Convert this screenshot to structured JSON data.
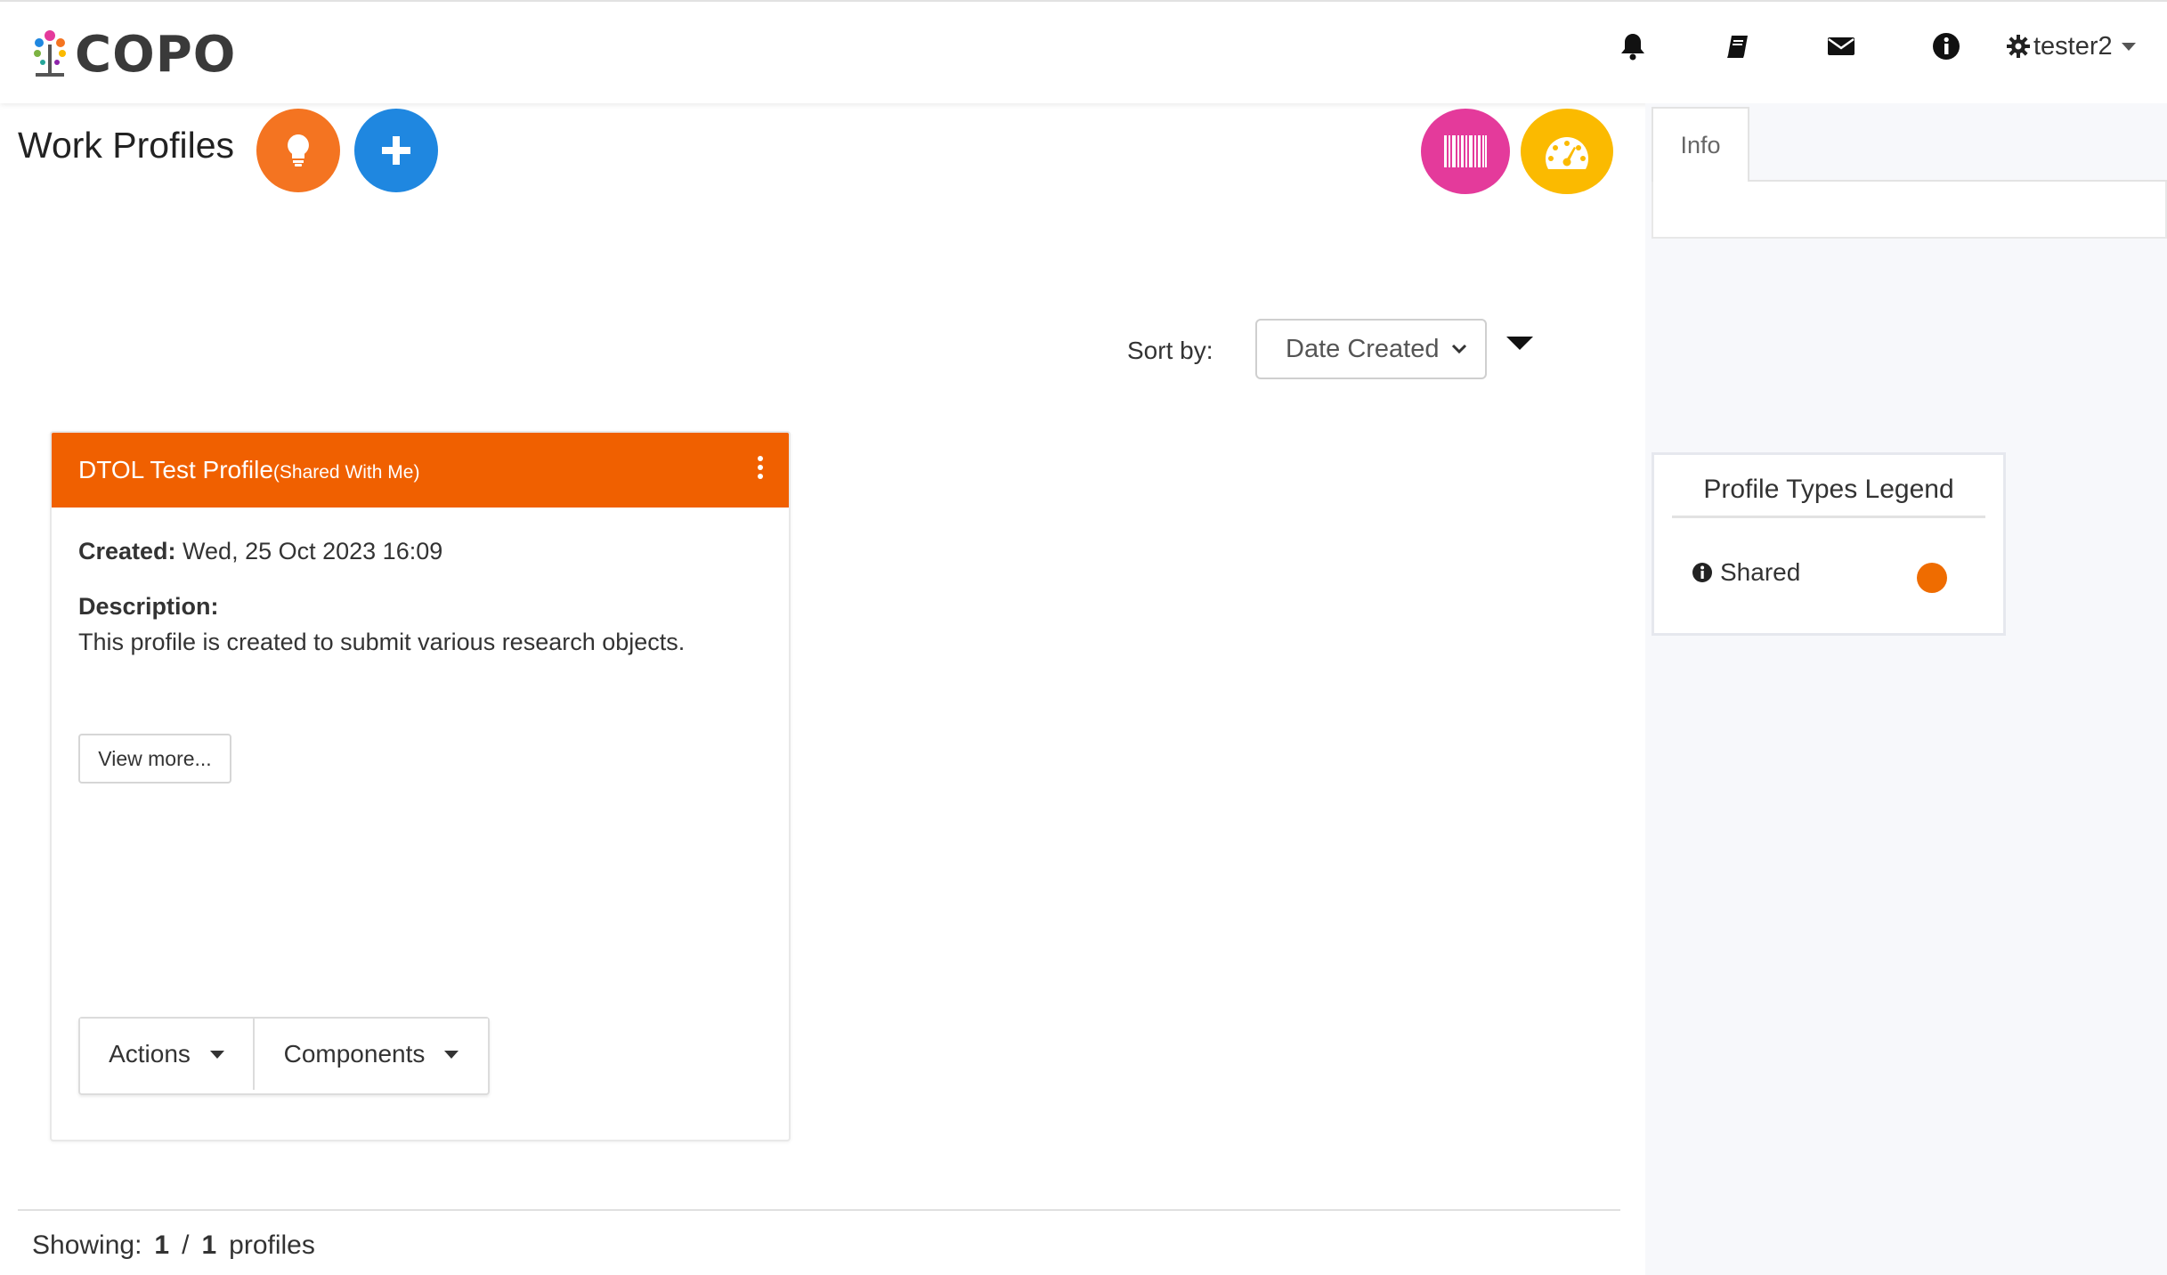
{
  "header": {
    "logo_text": "COPO",
    "user": "tester2",
    "icons": [
      "bell-icon",
      "book-icon",
      "envelope-icon",
      "info-circle-icon",
      "gear-icon"
    ]
  },
  "page": {
    "title": "Work Profiles",
    "buttons": {
      "tips": "lightbulb-icon",
      "add": "plus-icon",
      "barcode": "barcode-icon",
      "dashboard": "dashboard-icon"
    },
    "colors": {
      "orange": "#f47421",
      "blue": "#1f87e0",
      "pink": "#e43a9b",
      "yellow": "#fbba00"
    }
  },
  "sort": {
    "label": "Sort by:",
    "selected": "Date Created"
  },
  "profile_card": {
    "title": "DTOL Test Profile",
    "title_suffix": "(Shared With Me)",
    "created_label": "Created:",
    "created_value": "Wed, 25 Oct 2023 16:09",
    "description_label": "Description:",
    "description": "This profile is created to submit various research objects.",
    "view_more_label": "View more...",
    "actions_label": "Actions",
    "components_label": "Components",
    "header_color": "#f06000"
  },
  "footer": {
    "showing_label": "Showing:",
    "count": "1",
    "separator": "/",
    "total": "1",
    "unit": "profiles"
  },
  "side_panel": {
    "tab_info": "Info",
    "legend_title": "Profile Types Legend",
    "legend_items": [
      {
        "label": "Shared",
        "color": "#ef6c00"
      }
    ]
  }
}
